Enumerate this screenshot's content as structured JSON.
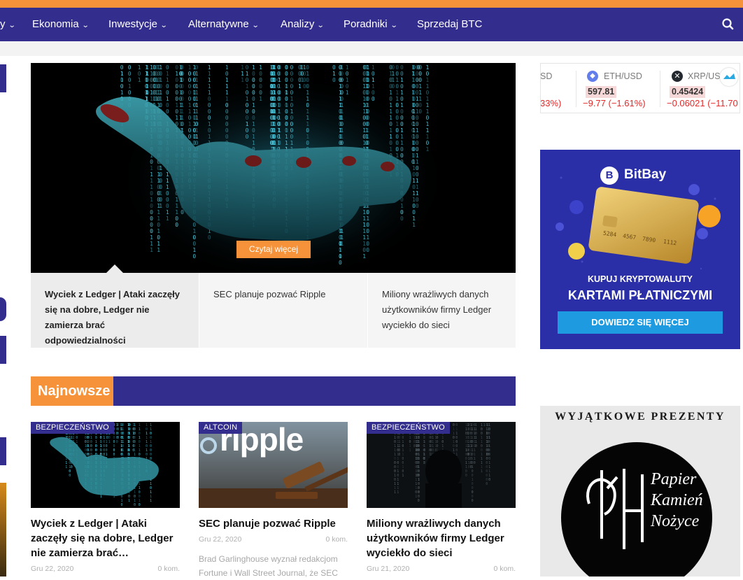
{
  "nav": {
    "items": [
      {
        "label": "y"
      },
      {
        "label": "Ekonomia"
      },
      {
        "label": "Inwestycje"
      },
      {
        "label": "Alternatywne"
      },
      {
        "label": "Analizy"
      },
      {
        "label": "Poradniki"
      },
      {
        "label": "Sprzedaj BTC"
      }
    ],
    "search_icon": "search-icon"
  },
  "hero": {
    "read_more": "Czytaj więcej",
    "tabs": [
      {
        "title": "Wyciek z Ledger | Ataki zaczęły się na dobre, Ledger nie zamierza brać odpowiedzialności"
      },
      {
        "title": "SEC planuje pozwać Ripple"
      },
      {
        "title": "Miliony wrażliwych danych użytkowników firmy Ledger wyciekło do sieci"
      }
    ]
  },
  "section": {
    "title": "Najnowsze"
  },
  "cards": [
    {
      "category": "BEZPIECZEŃSTWO",
      "title": "Wyciek z Ledger | Ataki zaczęły się na dobre, Ledger nie zamierza brać…",
      "date": "Gru 22, 2020",
      "comments": "0 kom.",
      "excerpt": ""
    },
    {
      "category": "ALTCOIN",
      "title": "SEC planuje pozwać Ripple",
      "date": "Gru 22, 2020",
      "comments": "0 kom.",
      "excerpt": "Brad Garlinghouse wyznał redakcjom Fortune i Wall Street Journal, że SEC",
      "thumb_text": "ripple"
    },
    {
      "category": "BEZPIECZEŃSTWO",
      "title": "Miliony wrażliwych danych użytkowników firmy Ledger wyciekło do sieci",
      "date": "Gru 21, 2020",
      "comments": "0 kom.",
      "excerpt": ""
    }
  ],
  "ticker": {
    "items": [
      {
        "symbol": "SD",
        "price": "",
        "change": "33%)"
      },
      {
        "symbol": "ETH/USD",
        "price": "597.81",
        "change": "−9.77 (−1.61%)"
      },
      {
        "symbol": "XRP/USD",
        "price": "0.45424",
        "change": "−0.06021 (−11.70"
      }
    ]
  },
  "ad_bitbay": {
    "brand": "BitBay",
    "line1": "KUPUJ KRYPTOWALUTY",
    "line2": "KARTAMI PŁATNICZYMI",
    "button": "DOWIEDZ SIĘ WIĘCEJ",
    "card_number_a": "5284",
    "card_number_b": "4567",
    "card_number_c": "7890",
    "card_number_d": "1112"
  },
  "ad_gifts": {
    "heading": "WYJĄTKOWE PREZENTY",
    "logo_line1": "Papier",
    "logo_line2": "Kamień",
    "logo_line3": "Nożyce"
  },
  "colors": {
    "brand": "#332d8d",
    "accent": "#f6923a",
    "negative": "#e22a2a"
  }
}
